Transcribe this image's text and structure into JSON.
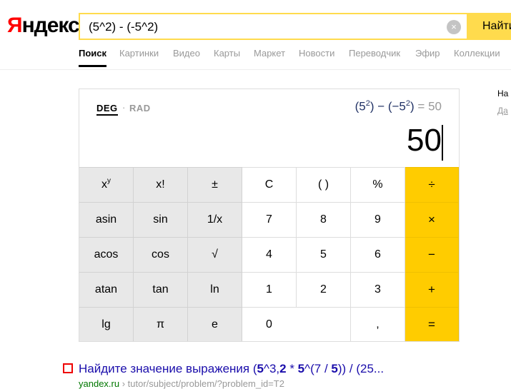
{
  "header": {
    "logo_y": "Я",
    "logo_rest": "ндекс",
    "search_value": "(5^2) - (-5^2)",
    "clear_icon": "×",
    "find_label": "Найти"
  },
  "tabs": [
    "Поиск",
    "Картинки",
    "Видео",
    "Карты",
    "Маркет",
    "Новости",
    "Переводчик",
    "Эфир",
    "Коллекции"
  ],
  "calculator": {
    "deg": "DEG",
    "dot": "·",
    "rad": "RAD",
    "expression": {
      "open1": "(5",
      "sup1": "2",
      "mid": ") − (−5",
      "sup2": "2",
      "close": ")",
      "equals": " = 50"
    },
    "result": "50",
    "keys": {
      "r1": [
        "x",
        "x!",
        "±",
        "C",
        "( )",
        "%",
        "÷"
      ],
      "xy_sup": "y",
      "r2": [
        "asin",
        "sin",
        "1/x",
        "7",
        "8",
        "9",
        "×"
      ],
      "r3": [
        "acos",
        "cos",
        "√",
        "4",
        "5",
        "6",
        "−"
      ],
      "r4": [
        "atan",
        "tan",
        "ln",
        "1",
        "2",
        "3",
        "+"
      ],
      "r5": [
        "lg",
        "π",
        "e",
        "0",
        ",",
        "="
      ]
    }
  },
  "result_snippet": {
    "title_a": "Найдите значение выражения (",
    "title_b": "5",
    "title_c": "^3,",
    "title_d": "2",
    "title_e": " * ",
    "title_f": "5",
    "title_g": "^(7 / ",
    "title_h": "5",
    "title_i": ")) / (25...",
    "url_domain": "yandex.ru",
    "url_path": " › tutor/subject/problem/?problem_id=T2"
  },
  "side": {
    "line1": "На",
    "line2": "Да"
  }
}
